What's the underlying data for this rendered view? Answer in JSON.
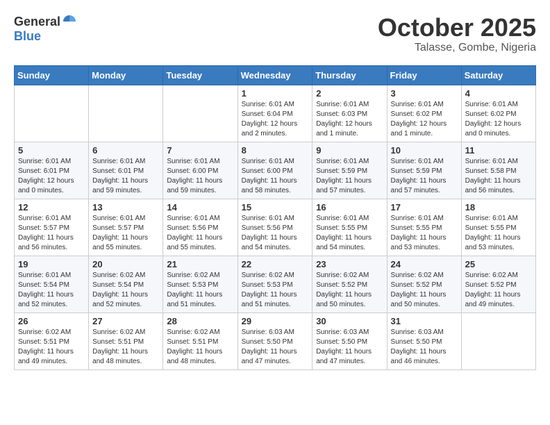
{
  "logo": {
    "general": "General",
    "blue": "Blue"
  },
  "title": "October 2025",
  "location": "Talasse, Gombe, Nigeria",
  "days_of_week": [
    "Sunday",
    "Monday",
    "Tuesday",
    "Wednesday",
    "Thursday",
    "Friday",
    "Saturday"
  ],
  "weeks": [
    [
      {
        "day": "",
        "info": ""
      },
      {
        "day": "",
        "info": ""
      },
      {
        "day": "",
        "info": ""
      },
      {
        "day": "1",
        "info": "Sunrise: 6:01 AM\nSunset: 6:04 PM\nDaylight: 12 hours and 2 minutes."
      },
      {
        "day": "2",
        "info": "Sunrise: 6:01 AM\nSunset: 6:03 PM\nDaylight: 12 hours and 1 minute."
      },
      {
        "day": "3",
        "info": "Sunrise: 6:01 AM\nSunset: 6:02 PM\nDaylight: 12 hours and 1 minute."
      },
      {
        "day": "4",
        "info": "Sunrise: 6:01 AM\nSunset: 6:02 PM\nDaylight: 12 hours and 0 minutes."
      }
    ],
    [
      {
        "day": "5",
        "info": "Sunrise: 6:01 AM\nSunset: 6:01 PM\nDaylight: 12 hours and 0 minutes."
      },
      {
        "day": "6",
        "info": "Sunrise: 6:01 AM\nSunset: 6:01 PM\nDaylight: 11 hours and 59 minutes."
      },
      {
        "day": "7",
        "info": "Sunrise: 6:01 AM\nSunset: 6:00 PM\nDaylight: 11 hours and 59 minutes."
      },
      {
        "day": "8",
        "info": "Sunrise: 6:01 AM\nSunset: 6:00 PM\nDaylight: 11 hours and 58 minutes."
      },
      {
        "day": "9",
        "info": "Sunrise: 6:01 AM\nSunset: 5:59 PM\nDaylight: 11 hours and 57 minutes."
      },
      {
        "day": "10",
        "info": "Sunrise: 6:01 AM\nSunset: 5:59 PM\nDaylight: 11 hours and 57 minutes."
      },
      {
        "day": "11",
        "info": "Sunrise: 6:01 AM\nSunset: 5:58 PM\nDaylight: 11 hours and 56 minutes."
      }
    ],
    [
      {
        "day": "12",
        "info": "Sunrise: 6:01 AM\nSunset: 5:57 PM\nDaylight: 11 hours and 56 minutes."
      },
      {
        "day": "13",
        "info": "Sunrise: 6:01 AM\nSunset: 5:57 PM\nDaylight: 11 hours and 55 minutes."
      },
      {
        "day": "14",
        "info": "Sunrise: 6:01 AM\nSunset: 5:56 PM\nDaylight: 11 hours and 55 minutes."
      },
      {
        "day": "15",
        "info": "Sunrise: 6:01 AM\nSunset: 5:56 PM\nDaylight: 11 hours and 54 minutes."
      },
      {
        "day": "16",
        "info": "Sunrise: 6:01 AM\nSunset: 5:55 PM\nDaylight: 11 hours and 54 minutes."
      },
      {
        "day": "17",
        "info": "Sunrise: 6:01 AM\nSunset: 5:55 PM\nDaylight: 11 hours and 53 minutes."
      },
      {
        "day": "18",
        "info": "Sunrise: 6:01 AM\nSunset: 5:55 PM\nDaylight: 11 hours and 53 minutes."
      }
    ],
    [
      {
        "day": "19",
        "info": "Sunrise: 6:01 AM\nSunset: 5:54 PM\nDaylight: 11 hours and 52 minutes."
      },
      {
        "day": "20",
        "info": "Sunrise: 6:02 AM\nSunset: 5:54 PM\nDaylight: 11 hours and 52 minutes."
      },
      {
        "day": "21",
        "info": "Sunrise: 6:02 AM\nSunset: 5:53 PM\nDaylight: 11 hours and 51 minutes."
      },
      {
        "day": "22",
        "info": "Sunrise: 6:02 AM\nSunset: 5:53 PM\nDaylight: 11 hours and 51 minutes."
      },
      {
        "day": "23",
        "info": "Sunrise: 6:02 AM\nSunset: 5:52 PM\nDaylight: 11 hours and 50 minutes."
      },
      {
        "day": "24",
        "info": "Sunrise: 6:02 AM\nSunset: 5:52 PM\nDaylight: 11 hours and 50 minutes."
      },
      {
        "day": "25",
        "info": "Sunrise: 6:02 AM\nSunset: 5:52 PM\nDaylight: 11 hours and 49 minutes."
      }
    ],
    [
      {
        "day": "26",
        "info": "Sunrise: 6:02 AM\nSunset: 5:51 PM\nDaylight: 11 hours and 49 minutes."
      },
      {
        "day": "27",
        "info": "Sunrise: 6:02 AM\nSunset: 5:51 PM\nDaylight: 11 hours and 48 minutes."
      },
      {
        "day": "28",
        "info": "Sunrise: 6:02 AM\nSunset: 5:51 PM\nDaylight: 11 hours and 48 minutes."
      },
      {
        "day": "29",
        "info": "Sunrise: 6:03 AM\nSunset: 5:50 PM\nDaylight: 11 hours and 47 minutes."
      },
      {
        "day": "30",
        "info": "Sunrise: 6:03 AM\nSunset: 5:50 PM\nDaylight: 11 hours and 47 minutes."
      },
      {
        "day": "31",
        "info": "Sunrise: 6:03 AM\nSunset: 5:50 PM\nDaylight: 11 hours and 46 minutes."
      },
      {
        "day": "",
        "info": ""
      }
    ]
  ]
}
